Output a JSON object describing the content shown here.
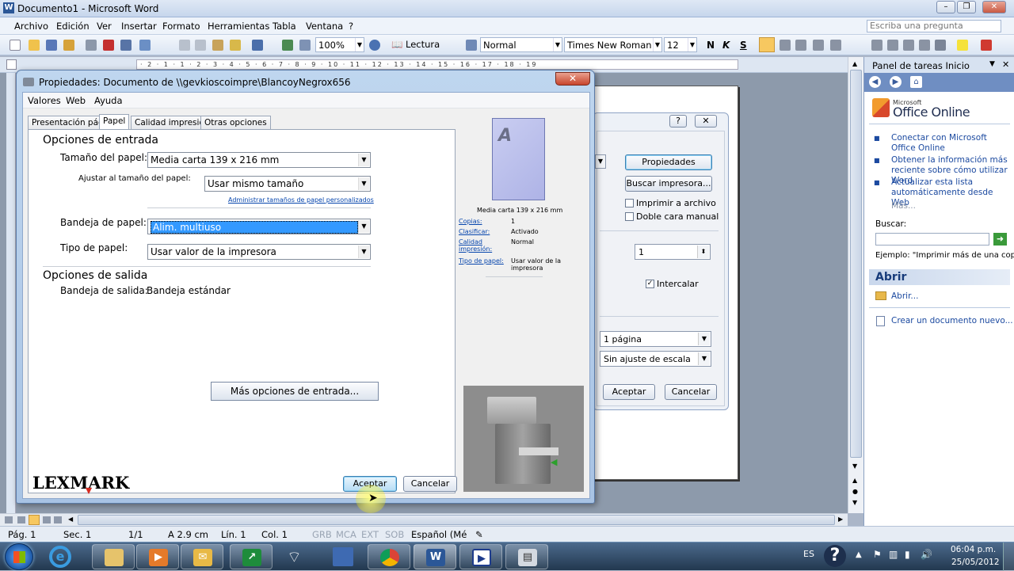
{
  "word": {
    "title": "Documento1 - Microsoft Word",
    "menus": [
      "Archivo",
      "Edición",
      "Ver",
      "Insertar",
      "Formato",
      "Herramientas",
      "Tabla",
      "Ventana",
      "?"
    ],
    "ask": "Escriba una pregunta",
    "zoom": "100%",
    "lectura": "Lectura",
    "style": "Normal",
    "font": "Times New Roman",
    "size": "12",
    "bold": "N",
    "italic": "K",
    "underline": "S",
    "ruler_text": "· 2 · 1 · 1 · 2 · 3 · 4 · 5 · 6 · 7 · 8 · 9 · 10 · 11 · 12 · 13 · 14 · 15 · 16 · 17 · 18 · 19",
    "min": "–",
    "max": "❐",
    "close": "✕"
  },
  "status": {
    "pag": "Pág. 1",
    "sec": "Sec. 1",
    "pages": "1/1",
    "pos": "A  2.9 cm",
    "lin": "Lín. 1",
    "col": "Col. 1",
    "grb": "GRB",
    "mca": "MCA",
    "ext": "EXT",
    "sob": "SOB",
    "lang": "Español (Mé"
  },
  "taskpane": {
    "title": "Panel de tareas Inicio",
    "logo_small": "Microsoft",
    "logo": "Office Online",
    "links": [
      "Conectar con Microsoft Office Online",
      "Obtener la información más reciente sobre cómo utilizar Word",
      "Actualizar esta lista automáticamente desde Web"
    ],
    "more": "Más...",
    "search_label": "Buscar:",
    "example": "Ejemplo:  \"Imprimir más de una copia\"",
    "section_open": "Abrir",
    "open_link": "Abrir...",
    "new_doc": "Crear un documento nuevo..."
  },
  "print": {
    "help": "?",
    "close": "✕",
    "propiedades": "Propiedades",
    "buscar": "Buscar impresora...",
    "imprimir_archivo": "Imprimir a archivo",
    "doble_cara": "Doble cara manual",
    "copies": "1",
    "intercalar": "Intercalar",
    "paginas": "1 página",
    "escala": "Sin ajuste de escala",
    "aceptar": "Aceptar",
    "cancelar": "Cancelar"
  },
  "props": {
    "title": "Propiedades: Documento de \\\\gevkioscoimpre\\BlancoyNegrox656",
    "menu": [
      "Valores",
      "Web",
      "Ayuda"
    ],
    "tabs": [
      "Presentación pág",
      "Papel",
      "Calidad impresión",
      "Otras opciones"
    ],
    "entrada_hd": "Opciones de entrada",
    "tamano_lbl": "Tamaño del papel:",
    "tamano_val": "Media carta 139 x 216 mm",
    "ajustar_lbl": "Ajustar al tamaño del papel:",
    "ajustar_val": "Usar mismo tamaño",
    "admin_link": "Administrar tamaños de papel personalizados",
    "bandeja_lbl": "Bandeja de papel:",
    "bandeja_val": "Alim. multiuso",
    "tipo_lbl": "Tipo de papel:",
    "tipo_val": "Usar valor de la impresora",
    "salida_hd": "Opciones de salida",
    "salida_lbl": "Bandeja de salida:",
    "salida_val": "Bandeja estándar",
    "mas_btn": "Más opciones de entrada...",
    "preview_letter": "A",
    "preview_size": "Media carta 139 x 216 mm",
    "summary": [
      {
        "k": "Copias:",
        "v": "1"
      },
      {
        "k": "Clasificar:",
        "v": "Activado"
      },
      {
        "k": "Calidad impresión:",
        "v": "Normal"
      },
      {
        "k": "Tipo de papel:",
        "v": "Usar valor de la impresora"
      }
    ],
    "brand": "LEXMARK",
    "aceptar": "Aceptar",
    "cancelar": "Cancelar"
  },
  "taskbar": {
    "lang": "ES",
    "time": "06:04 p.m.",
    "date": "25/05/2012"
  }
}
